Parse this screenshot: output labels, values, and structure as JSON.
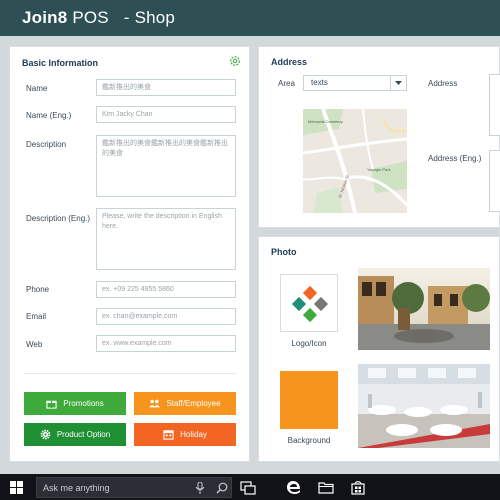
{
  "app": {
    "brand": "Join8",
    "product": "POS",
    "page": "- Shop"
  },
  "basic": {
    "title": "Basic Information",
    "labels": {
      "name": "Name",
      "name_eng": "Name (Eng.)",
      "description": "Description",
      "description_eng": "Description (Eng.)",
      "phone": "Phone",
      "email": "Email",
      "web": "Web"
    },
    "values": {
      "name": "鑑新推出的美食",
      "name_eng": "Kim Jacky Chan",
      "description": "鑑新推出的美食鑑新推出的美食鑑新推出的美食"
    },
    "placeholders": {
      "description_eng": "Please, write the description in English here.",
      "phone": "ex. +09 225 4855 5860",
      "email": "ex. chan@example.com",
      "web": "ex. www.example.com"
    },
    "buttons": {
      "promotions": "Promotions",
      "staff": "Staff/Employee",
      "product_option": "Product Option",
      "holiday": "Holiday"
    }
  },
  "address": {
    "title": "Address",
    "area_label": "Area",
    "area_value": "texts",
    "address_label": "Address",
    "address_eng_label": "Address (Eng.)",
    "map_labels": {
      "cemetery": "Memorial Cemetery",
      "park": "Youngle Park",
      "street": "St. Nicolas St"
    }
  },
  "photo": {
    "title": "Photo",
    "logo_caption": "Logo/Icon",
    "background_caption": "Background",
    "background_color": "#f7941e"
  },
  "taskbar": {
    "search_placeholder": "Ask me anything"
  },
  "colors": {
    "titlebar": "#2e4f53",
    "green": "#3eaa3b",
    "orange": "#f7941e",
    "dark_green": "#1f8f33",
    "red_orange": "#f26523"
  },
  "icons": [
    "gear-icon",
    "gift-icon",
    "people-icon",
    "settings-cog-icon",
    "calendar-icon",
    "chevron-down-icon",
    "windows-start-icon",
    "microphone-icon",
    "search-icon",
    "task-view-icon",
    "edge-icon",
    "file-explorer-icon",
    "store-icon"
  ]
}
